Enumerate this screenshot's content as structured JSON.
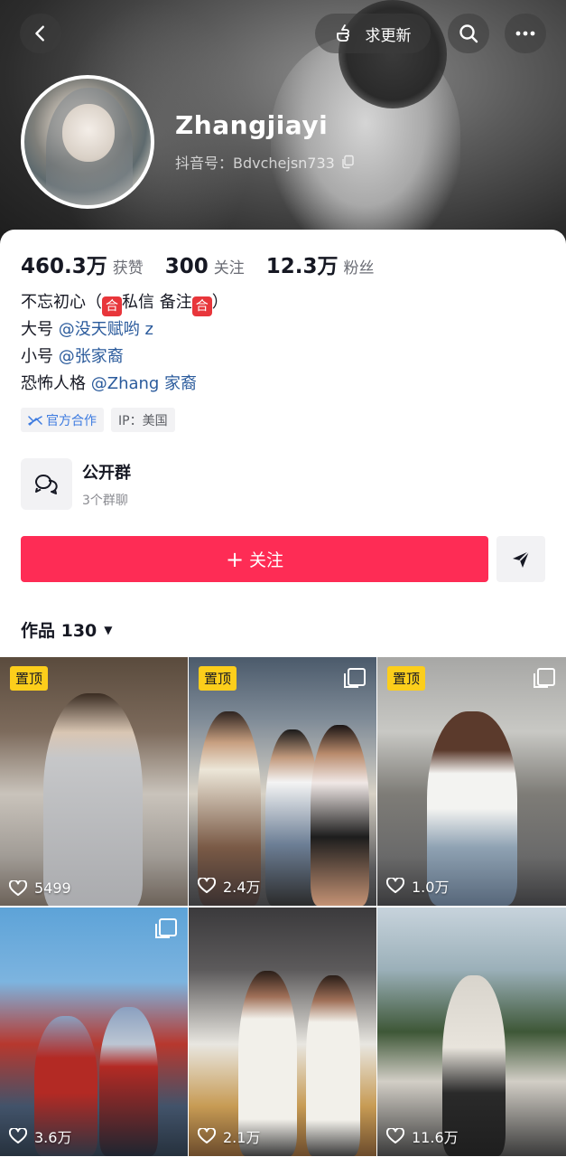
{
  "header": {
    "update_label": "求更新"
  },
  "profile": {
    "username": "Zhangjiayi",
    "douyin_id": "抖音号：Bdvchejsn733"
  },
  "stats": [
    {
      "value": "460.3万",
      "label": "获赞"
    },
    {
      "value": "300",
      "label": "关注"
    },
    {
      "value": "12.3万",
      "label": "粉丝"
    }
  ],
  "bio": {
    "line1_prefix": "不忘初心（",
    "line1_he1": "合",
    "line1_mid": "私信 备注",
    "line1_he2": "合",
    "line1_suffix": "）",
    "line2_prefix": "大号 ",
    "line2_mention": "@没天赋哟 z",
    "line3_prefix": "小号 ",
    "line3_mention": "@张家裔",
    "line4_prefix": "恐怖人格 ",
    "line4_mention": "@Zhang 家裔"
  },
  "tags": {
    "official": "官方合作",
    "ip": "IP：美国"
  },
  "group": {
    "title": "公开群",
    "subtitle": "3个群聊"
  },
  "actions": {
    "follow_label": "关注",
    "follow_plus": "+"
  },
  "works": {
    "label": "作品 130"
  },
  "videos": [
    {
      "pinned": "置顶",
      "likes": "5499",
      "multi": false
    },
    {
      "pinned": "置顶",
      "likes": "2.4万",
      "multi": true
    },
    {
      "pinned": "置顶",
      "likes": "1.0万",
      "multi": true
    },
    {
      "pinned": "",
      "likes": "3.6万",
      "multi": true
    },
    {
      "pinned": "",
      "likes": "2.1万",
      "multi": false
    },
    {
      "pinned": "",
      "likes": "11.6万",
      "multi": false
    }
  ],
  "colors": {
    "follow_button": "#fe2c55",
    "mention": "#2b5b9c",
    "pin_badge": "#fcce1b",
    "official_tag": "#3d7be0"
  }
}
